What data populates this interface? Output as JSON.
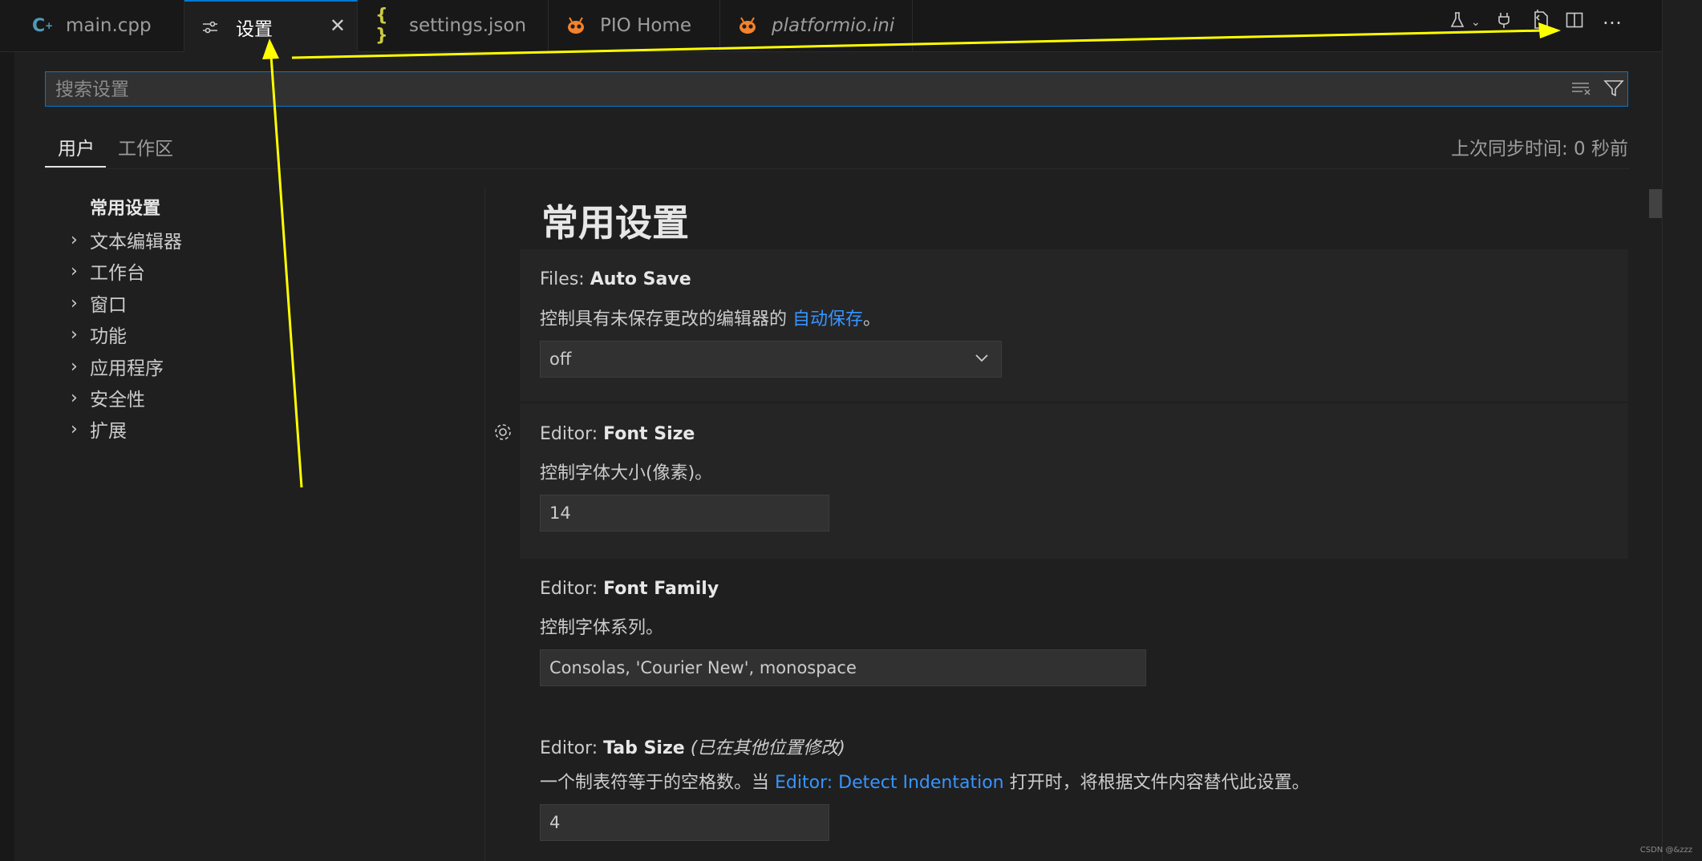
{
  "tabs": [
    {
      "label": "main.cpp",
      "icon": "cpp-file-icon"
    },
    {
      "label": "设置",
      "icon": "settings-editor-icon",
      "close": "✕"
    },
    {
      "label": "settings.json",
      "icon": "json-braces-icon"
    },
    {
      "label": "PIO Home",
      "icon": "platformio-alien-icon"
    },
    {
      "label": "platformio.ini",
      "icon": "platformio-alien-icon"
    }
  ],
  "search": {
    "placeholder": "搜索设置"
  },
  "scopes": {
    "user": "用户",
    "workspace": "工作区"
  },
  "sync_status": "上次同步时间: 0 秒前",
  "toc": {
    "active": "常用设置",
    "items": [
      "文本编辑器",
      "工作台",
      "窗口",
      "功能",
      "应用程序",
      "安全性",
      "扩展"
    ]
  },
  "section_title": "常用设置",
  "settings": [
    {
      "category": "Files: ",
      "name": "Auto Save",
      "desc_before": "控制具有未保存更改的编辑器的 ",
      "desc_link": "自动保存",
      "desc_after": "。",
      "value": "off"
    },
    {
      "category": "Editor: ",
      "name": "Font Size",
      "desc": "控制字体大小(像素)。",
      "value": "14"
    },
    {
      "category": "Editor: ",
      "name": "Font Family",
      "desc": "控制字体系列。",
      "value": "Consolas, 'Courier New', monospace"
    },
    {
      "category": "Editor: ",
      "name": "Tab Size",
      "modified_note": "(已在其他位置修改)",
      "desc_before": "一个制表符等于的空格数。当 ",
      "desc_link": "Editor: Detect Indentation",
      "desc_after": " 打开时，将根据文件内容替代此设置。",
      "value": "4"
    }
  ],
  "watermark": "CSDN @&zzz",
  "colors": {
    "accent": "#0078d4",
    "link": "#3794ff",
    "annotation_arrow": "#ffff00"
  }
}
